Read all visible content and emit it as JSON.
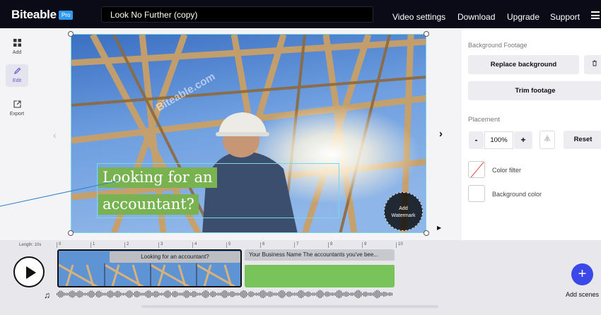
{
  "app": {
    "brand": "Biteable",
    "tier_badge": "Pro",
    "project_title": "Look No Further (copy)"
  },
  "nav": {
    "video_settings": "Video settings",
    "download": "Download",
    "upgrade": "Upgrade",
    "support": "Support",
    "menu_icon": "hamburger-menu-icon"
  },
  "tools": [
    {
      "label": "Add",
      "icon": "grid-icon"
    },
    {
      "label": "Edit",
      "icon": "pencil-icon"
    },
    {
      "label": "Export",
      "icon": "export-icon"
    }
  ],
  "canvas": {
    "headline_line1": "Looking for an",
    "headline_line2": "accountant?",
    "watermark_text": "Biteable.com",
    "watermark_button_line1": "Add",
    "watermark_button_line2": "Watermark",
    "prev_arrow": "‹",
    "next_arrow": "›",
    "play_glyph": "▶"
  },
  "panel": {
    "background_footage_label": "Background Footage",
    "replace_background": "Replace background",
    "delete_icon": "trash-icon",
    "trim_footage": "Trim footage",
    "placement_label": "Placement",
    "zoom_decrease": "-",
    "zoom_value": "100%",
    "zoom_increase": "+",
    "flip_icon": "flip-icon",
    "reset": "Reset",
    "color_filter": "Color filter",
    "background_color": "Background color"
  },
  "timeline": {
    "length_label": "Length: 10s",
    "ticks": [
      "0",
      "1",
      "2",
      "3",
      "4",
      "5",
      "6",
      "7",
      "8",
      "9",
      "10"
    ],
    "scene1_label": "Looking for an accountant?",
    "scene2_label": "Your Business Name The accountants you've bee...",
    "add_scenes": "Add scenes",
    "audio_icon": "music-note-icon"
  },
  "colors": {
    "headline_bg": "#78b251",
    "selection_outline": "#7ad7e6",
    "accent_blue": "#3b48e8",
    "edit_purple": "#6b4fd8",
    "pro_badge": "#2f9bf0"
  }
}
